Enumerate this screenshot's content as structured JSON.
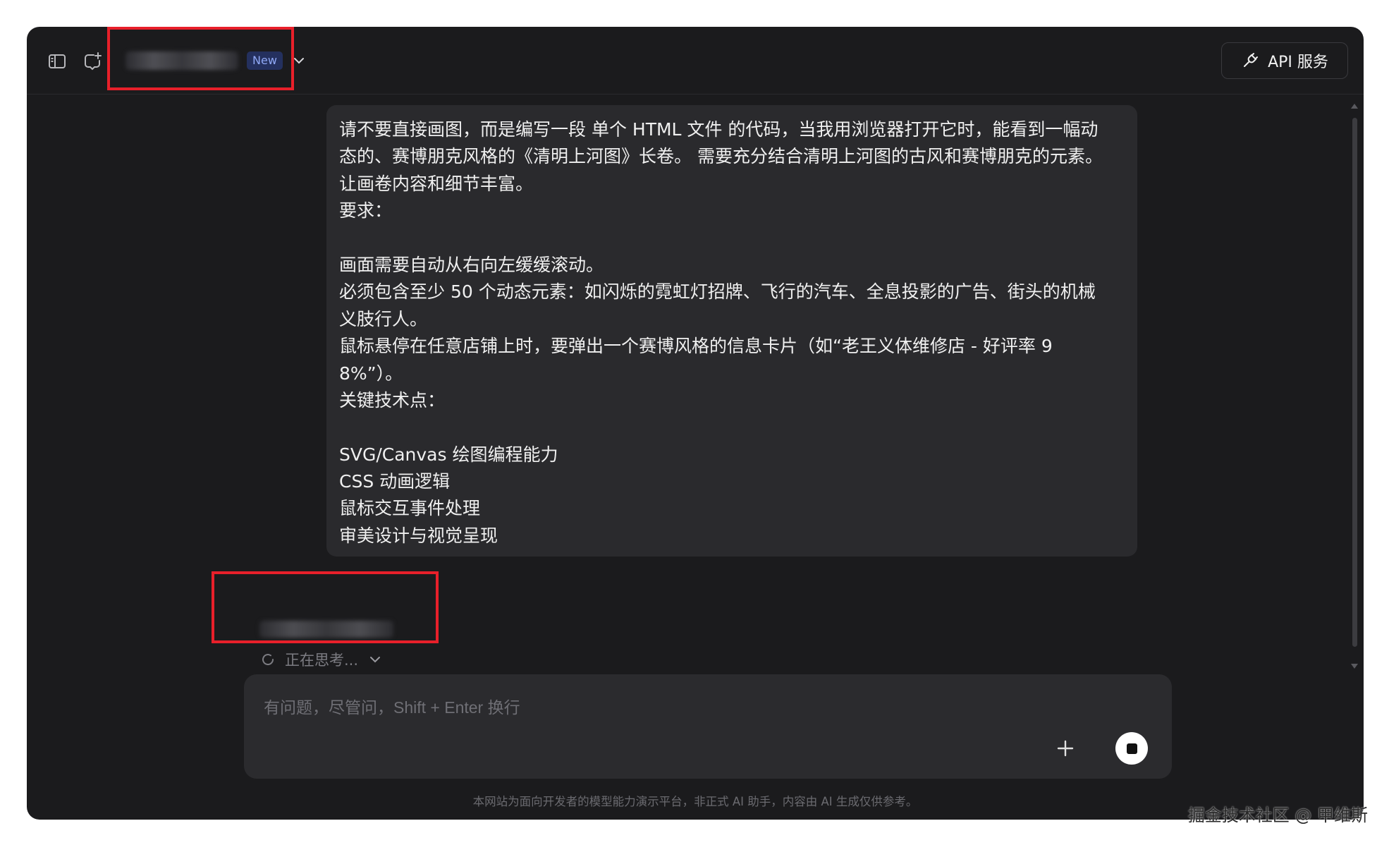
{
  "header": {
    "badge": "New",
    "api_button": "API 服务"
  },
  "user_message": {
    "lines": [
      "请不要直接画图，而是编写一段 单个 HTML 文件 的代码，当我用浏览器打开它时，能看到一幅动",
      "态的、赛博朋克风格的《清明上河图》长卷。 需要充分结合清明上河图的古风和赛博朋克的元素。",
      "让画卷内容和细节丰富。",
      "要求：",
      "",
      "画面需要自动从右向左缓缓滚动。",
      "必须包含至少 50 个动态元素：如闪烁的霓虹灯招牌、飞行的汽车、全息投影的广告、街头的机械",
      "义肢行人。",
      "鼠标悬停在任意店铺上时，要弹出一个赛博风格的信息卡片（如“老王义体维修店 - 好评率 9",
      "8%”）。",
      "关键技术点：",
      "",
      "SVG/Canvas 绘图编程能力",
      "CSS 动画逻辑",
      "鼠标交互事件处理",
      "审美设计与视觉呈现"
    ]
  },
  "assistant": {
    "status": "正在思考..."
  },
  "composer": {
    "placeholder": "有问题，尽管问，Shift + Enter 换行"
  },
  "footer": {
    "note": "本网站为面向开发者的模型能力演示平台，非正式 AI 助手，内容由 AI 生成仅供参考。"
  },
  "watermark": "掘金技术社区 @ 甲维斯",
  "colors": {
    "background": "#1b1b1d",
    "bubble": "#2a2a2d",
    "highlight": "#e8202a",
    "badge_bg": "#24305e",
    "badge_text": "#8fa8f5"
  }
}
